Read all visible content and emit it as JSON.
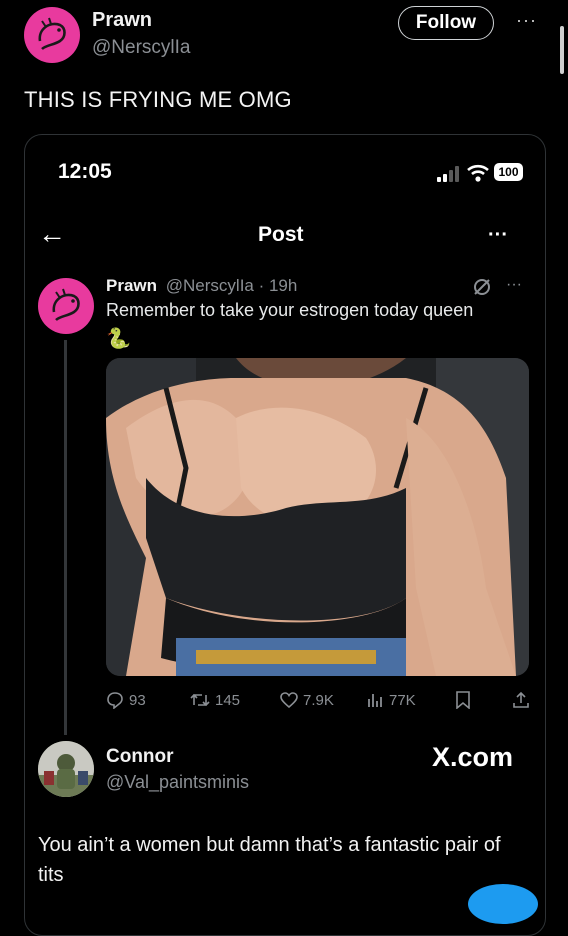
{
  "header": {
    "display_name": "Prawn",
    "handle": "@NerscylIa",
    "follow_label": "Follow",
    "more_label": "···"
  },
  "tweet": {
    "text": "THIS IS FRYING ME OMG"
  },
  "embedded": {
    "status_time": "12:05",
    "battery": "100",
    "back_label": "←",
    "title": "Post",
    "more_label": "···",
    "post": {
      "display_name": "Prawn",
      "meta": "@NerscylIa · 19h",
      "more_label": "···",
      "text": "Remember to take your estrogen today queen",
      "emoji": "🐍",
      "actions": {
        "replies": "93",
        "reposts": "145",
        "likes": "7.9K",
        "views": "77K"
      }
    },
    "reply": {
      "display_name": "Connor",
      "handle": "@Val_paintsminis",
      "text": "You ain’t a women but damn that’s a fantastic pair of tits"
    },
    "watermark": "X.com"
  },
  "colors": {
    "avatar_pink": "#e83a9e",
    "muted_text": "#8b8f94",
    "accent_blue": "#1d9bf0"
  }
}
